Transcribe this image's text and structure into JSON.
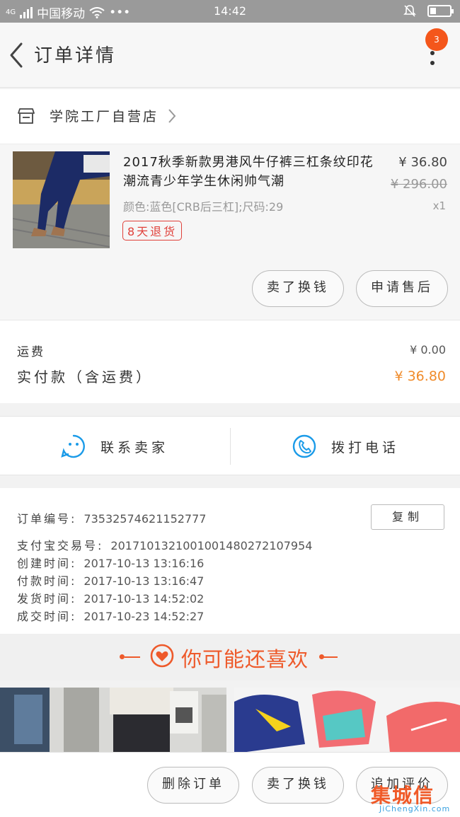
{
  "status_bar": {
    "signal": "4G",
    "carrier": "中国移动",
    "dots": "•••",
    "time": "14:42"
  },
  "header": {
    "title": "订单详情",
    "badge_count": "3"
  },
  "shop": {
    "name": "学院工厂自营店"
  },
  "product": {
    "title": "2017秋季新款男港风牛仔裤三杠条纹印花潮流青少年学生休闲帅气潮",
    "sku": "颜色:蓝色[CRB后三杠];尺码:29",
    "tag": "8天退货",
    "price": "¥ 36.80",
    "original_price": "¥ 296.00",
    "quantity": "x1",
    "btn_resell": "卖了换钱",
    "btn_aftersale": "申请售后"
  },
  "fees": {
    "shipping_label": "运费",
    "shipping_value": "¥ 0.00",
    "paid_label": "实付款（含运费）",
    "paid_value": "¥ 36.80"
  },
  "contact": {
    "seller": "联系卖家",
    "call": "拨打电话"
  },
  "order_info": {
    "copy_label": "复制",
    "rows": [
      {
        "label": "订单编号:",
        "value": "73532574621152777"
      },
      {
        "label": "支付宝交易号:",
        "value": "2017101321001001480272107954"
      },
      {
        "label": "创建时间:",
        "value": "2017-10-13 13:16:16"
      },
      {
        "label": "付款时间:",
        "value": "2017-10-13 13:16:47"
      },
      {
        "label": "发货时间:",
        "value": "2017-10-13 14:52:02"
      },
      {
        "label": "成交时间:",
        "value": "2017-10-23 14:52:27"
      }
    ]
  },
  "recommend": {
    "title": "你可能还喜欢"
  },
  "bottom_bar": {
    "delete": "删除订单",
    "resell": "卖了换钱",
    "review": "追加评价"
  },
  "watermark": {
    "cn": "集城信",
    "en": "JiChengXin.com"
  },
  "colors": {
    "accent": "#ee5a2b",
    "price_orange": "#f08b2a",
    "tag_red": "#e0403a",
    "contact_blue": "#1b9be8"
  }
}
